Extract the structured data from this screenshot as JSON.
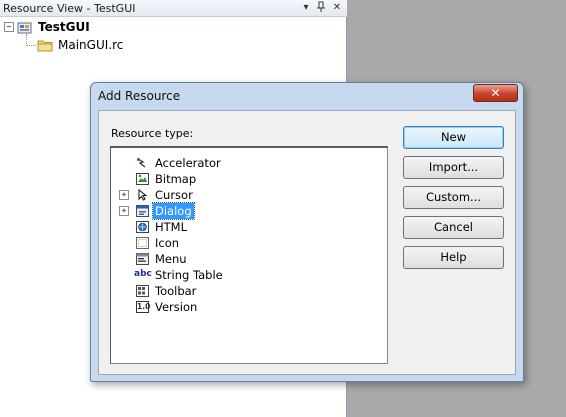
{
  "resource_view": {
    "title": "Resource View - TestGUI",
    "pin_glyph": "▾",
    "dock_glyph": "ꟾ",
    "close_glyph": "✕",
    "tree": {
      "root": {
        "label": "TestGUI",
        "expander": "−"
      },
      "children": [
        {
          "label": "MainGUI.rc"
        }
      ]
    }
  },
  "dialog": {
    "title": "Add Resource",
    "close_glyph": "✕",
    "resource_type_label": "Resource type:",
    "tree_items": [
      {
        "label": "Accelerator",
        "icon": "accelerator-icon",
        "expander": ""
      },
      {
        "label": "Bitmap",
        "icon": "bitmap-icon",
        "expander": ""
      },
      {
        "label": "Cursor",
        "icon": "cursor-icon",
        "expander": "+"
      },
      {
        "label": "Dialog",
        "icon": "dialog-icon",
        "expander": "+",
        "selected": true
      },
      {
        "label": "HTML",
        "icon": "html-icon",
        "expander": ""
      },
      {
        "label": "Icon",
        "icon": "icon-icon",
        "expander": ""
      },
      {
        "label": "Menu",
        "icon": "menu-icon",
        "expander": ""
      },
      {
        "label": "String Table",
        "icon": "string-table-icon",
        "expander": "",
        "icon_text": "abc"
      },
      {
        "label": "Toolbar",
        "icon": "toolbar-icon",
        "expander": ""
      },
      {
        "label": "Version",
        "icon": "version-icon",
        "expander": "",
        "icon_text": "1.0"
      }
    ],
    "buttons": {
      "new": "New",
      "import": "Import...",
      "custom": "Custom...",
      "cancel": "Cancel",
      "help": "Help"
    }
  }
}
